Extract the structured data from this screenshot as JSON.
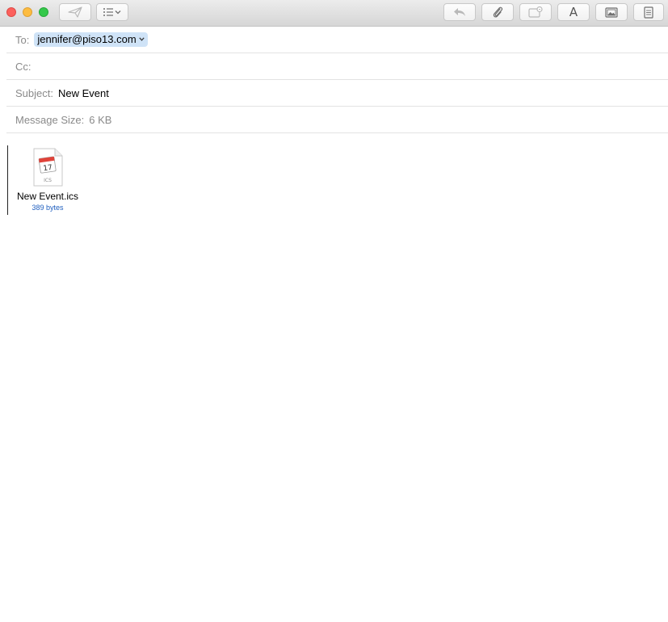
{
  "toolbar": {
    "buttons": [
      {
        "name": "send-icon",
        "enabled": false
      },
      {
        "name": "header-fields-icon",
        "enabled": true
      },
      {
        "name": "reply-icon",
        "enabled": false
      },
      {
        "name": "paperclip-icon",
        "enabled": true
      },
      {
        "name": "markup-icon",
        "enabled": false
      },
      {
        "name": "font-icon",
        "label": "A",
        "enabled": true
      },
      {
        "name": "photo-browser-icon",
        "enabled": true
      },
      {
        "name": "stationery-icon",
        "enabled": true
      }
    ]
  },
  "header": {
    "to_label": "To:",
    "to_value": "jennifer@piso13.com",
    "cc_label": "Cc:",
    "cc_value": "",
    "subject_label": "Subject:",
    "subject_value": "New Event",
    "size_label": "Message Size:",
    "size_value": "6 KB"
  },
  "attachment": {
    "name": "New Event.ics",
    "size": "389 bytes",
    "icon_day": "17",
    "icon_ext": "ICS"
  },
  "colors": {
    "recipient_bg": "#cfe3f7",
    "size_link": "#1f5fbf",
    "close": "#fc605c",
    "minimize": "#fdbc40",
    "zoom": "#34c84a"
  }
}
